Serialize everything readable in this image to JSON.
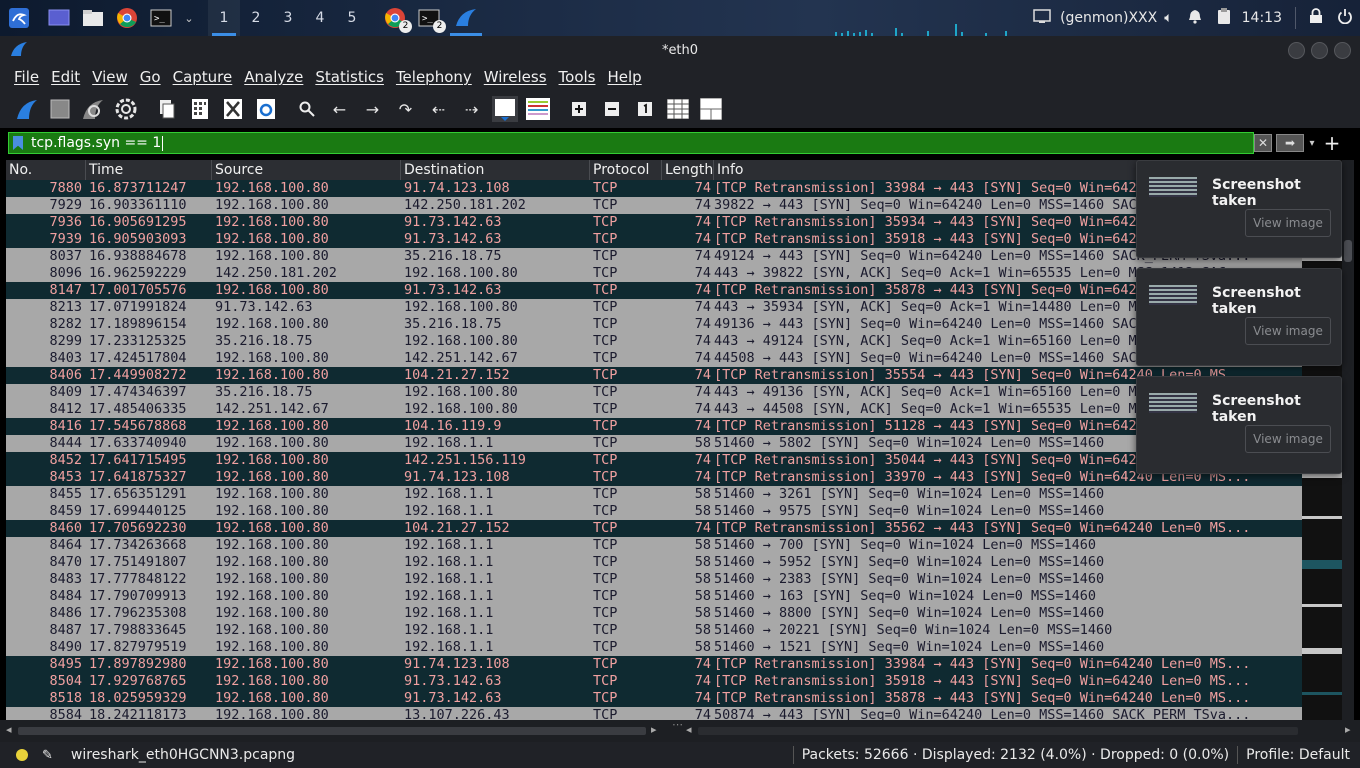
{
  "taskbar": {
    "workspaces": [
      "1",
      "2",
      "3",
      "4",
      "5"
    ],
    "chrome_badge": "2",
    "terminal_badge": "2",
    "genmon": "(genmon)XXX",
    "clock": "14:13"
  },
  "window": {
    "title": "*eth0"
  },
  "menu": [
    "File",
    "Edit",
    "View",
    "Go",
    "Capture",
    "Analyze",
    "Statistics",
    "Telephony",
    "Wireless",
    "Tools",
    "Help"
  ],
  "filter": {
    "value": "tcp.flags.syn == 1"
  },
  "columns": [
    "No.",
    "Time",
    "Source",
    "Destination",
    "Protocol",
    "Length",
    "Info"
  ],
  "packets": [
    {
      "no": "7880",
      "time": "16.873711247",
      "src": "192.168.100.80",
      "dst": "91.74.123.108",
      "proto": "TCP",
      "len": "74",
      "info": "[TCP Retransmission] 33984 → 443 [SYN] Seq=0 Win=64240 Len=0 MS...",
      "bad": true
    },
    {
      "no": "7929",
      "time": "16.903361110",
      "src": "192.168.100.80",
      "dst": "142.250.181.202",
      "proto": "TCP",
      "len": "74",
      "info": "39822 → 443 [SYN] Seq=0 Win=64240 Len=0 MSS=1460 SACK_PERM TSva...",
      "bad": false
    },
    {
      "no": "7936",
      "time": "16.905691295",
      "src": "192.168.100.80",
      "dst": "91.73.142.63",
      "proto": "TCP",
      "len": "74",
      "info": "[TCP Retransmission] 35934 → 443 [SYN] Seq=0 Win=64240 Len=0 MS...",
      "bad": true
    },
    {
      "no": "7939",
      "time": "16.905903093",
      "src": "192.168.100.80",
      "dst": "91.73.142.63",
      "proto": "TCP",
      "len": "74",
      "info": "[TCP Retransmission] 35918 → 443 [SYN] Seq=0 Win=64240 Len=0 MS...",
      "bad": true
    },
    {
      "no": "8037",
      "time": "16.938884678",
      "src": "192.168.100.80",
      "dst": "35.216.18.75",
      "proto": "TCP",
      "len": "74",
      "info": "49124 → 443 [SYN] Seq=0 Win=64240 Len=0 MSS=1460 SACK_PERM TSva...",
      "bad": false
    },
    {
      "no": "8096",
      "time": "16.962592229",
      "src": "142.250.181.202",
      "dst": "192.168.100.80",
      "proto": "TCP",
      "len": "74",
      "info": "443 → 39822 [SYN, ACK] Seq=0 Ack=1 Win=65535 Len=0 MSS=1412 SAC...",
      "bad": false
    },
    {
      "no": "8147",
      "time": "17.001705576",
      "src": "192.168.100.80",
      "dst": "91.73.142.63",
      "proto": "TCP",
      "len": "74",
      "info": "[TCP Retransmission] 35878 → 443 [SYN] Seq=0 Win=64240 Len=0 MS...",
      "bad": true
    },
    {
      "no": "8213",
      "time": "17.071991824",
      "src": "91.73.142.63",
      "dst": "192.168.100.80",
      "proto": "TCP",
      "len": "74",
      "info": "443 → 35934 [SYN, ACK] Seq=0 Ack=1 Win=14480 Len=0 MSS=1412 SAC...",
      "bad": false
    },
    {
      "no": "8282",
      "time": "17.189896154",
      "src": "192.168.100.80",
      "dst": "35.216.18.75",
      "proto": "TCP",
      "len": "74",
      "info": "49136 → 443 [SYN] Seq=0 Win=64240 Len=0 MSS=1460 SACK_PERM TSva...",
      "bad": false
    },
    {
      "no": "8299",
      "time": "17.233125325",
      "src": "35.216.18.75",
      "dst": "192.168.100.80",
      "proto": "TCP",
      "len": "74",
      "info": "443 → 49124 [SYN, ACK] Seq=0 Ack=1 Win=65160 Len=0 MSS=1412 SAC...",
      "bad": false
    },
    {
      "no": "8403",
      "time": "17.424517804",
      "src": "192.168.100.80",
      "dst": "142.251.142.67",
      "proto": "TCP",
      "len": "74",
      "info": "44508 → 443 [SYN] Seq=0 Win=64240 Len=0 MSS=1460 SACK_PERM TSva...",
      "bad": false
    },
    {
      "no": "8406",
      "time": "17.449908272",
      "src": "192.168.100.80",
      "dst": "104.21.27.152",
      "proto": "TCP",
      "len": "74",
      "info": "[TCP Retransmission] 35554 → 443 [SYN] Seq=0 Win=64240 Len=0 MS...",
      "bad": true
    },
    {
      "no": "8409",
      "time": "17.474346397",
      "src": "35.216.18.75",
      "dst": "192.168.100.80",
      "proto": "TCP",
      "len": "74",
      "info": "443 → 49136 [SYN, ACK] Seq=0 Ack=1 Win=65160 Len=0 MSS=1412 SAC...",
      "bad": false
    },
    {
      "no": "8412",
      "time": "17.485406335",
      "src": "142.251.142.67",
      "dst": "192.168.100.80",
      "proto": "TCP",
      "len": "74",
      "info": "443 → 44508 [SYN, ACK] Seq=0 Ack=1 Win=65535 Len=0 MSS=1412 SAC...",
      "bad": false
    },
    {
      "no": "8416",
      "time": "17.545678868",
      "src": "192.168.100.80",
      "dst": "104.16.119.9",
      "proto": "TCP",
      "len": "74",
      "info": "[TCP Retransmission] 51128 → 443 [SYN] Seq=0 Win=64240 Len=0 MS...",
      "bad": true
    },
    {
      "no": "8444",
      "time": "17.633740940",
      "src": "192.168.100.80",
      "dst": "192.168.1.1",
      "proto": "TCP",
      "len": "58",
      "info": "51460 → 5802 [SYN] Seq=0 Win=1024 Len=0 MSS=1460",
      "bad": false
    },
    {
      "no": "8452",
      "time": "17.641715495",
      "src": "192.168.100.80",
      "dst": "142.251.156.119",
      "proto": "TCP",
      "len": "74",
      "info": "[TCP Retransmission] 35044 → 443 [SYN] Seq=0 Win=64240 Len=0 MS...",
      "bad": true
    },
    {
      "no": "8453",
      "time": "17.641875327",
      "src": "192.168.100.80",
      "dst": "91.74.123.108",
      "proto": "TCP",
      "len": "74",
      "info": "[TCP Retransmission] 33970 → 443 [SYN] Seq=0 Win=64240 Len=0 MS...",
      "bad": true
    },
    {
      "no": "8455",
      "time": "17.656351291",
      "src": "192.168.100.80",
      "dst": "192.168.1.1",
      "proto": "TCP",
      "len": "58",
      "info": "51460 → 3261 [SYN] Seq=0 Win=1024 Len=0 MSS=1460",
      "bad": false
    },
    {
      "no": "8459",
      "time": "17.699440125",
      "src": "192.168.100.80",
      "dst": "192.168.1.1",
      "proto": "TCP",
      "len": "58",
      "info": "51460 → 9575 [SYN] Seq=0 Win=1024 Len=0 MSS=1460",
      "bad": false
    },
    {
      "no": "8460",
      "time": "17.705692230",
      "src": "192.168.100.80",
      "dst": "104.21.27.152",
      "proto": "TCP",
      "len": "74",
      "info": "[TCP Retransmission] 35562 → 443 [SYN] Seq=0 Win=64240 Len=0 MS...",
      "bad": true
    },
    {
      "no": "8464",
      "time": "17.734263668",
      "src": "192.168.100.80",
      "dst": "192.168.1.1",
      "proto": "TCP",
      "len": "58",
      "info": "51460 → 700 [SYN] Seq=0 Win=1024 Len=0 MSS=1460",
      "bad": false
    },
    {
      "no": "8470",
      "time": "17.751491807",
      "src": "192.168.100.80",
      "dst": "192.168.1.1",
      "proto": "TCP",
      "len": "58",
      "info": "51460 → 5952 [SYN] Seq=0 Win=1024 Len=0 MSS=1460",
      "bad": false
    },
    {
      "no": "8483",
      "time": "17.777848122",
      "src": "192.168.100.80",
      "dst": "192.168.1.1",
      "proto": "TCP",
      "len": "58",
      "info": "51460 → 2383 [SYN] Seq=0 Win=1024 Len=0 MSS=1460",
      "bad": false
    },
    {
      "no": "8484",
      "time": "17.790709913",
      "src": "192.168.100.80",
      "dst": "192.168.1.1",
      "proto": "TCP",
      "len": "58",
      "info": "51460 → 163 [SYN] Seq=0 Win=1024 Len=0 MSS=1460",
      "bad": false
    },
    {
      "no": "8486",
      "time": "17.796235308",
      "src": "192.168.100.80",
      "dst": "192.168.1.1",
      "proto": "TCP",
      "len": "58",
      "info": "51460 → 8800 [SYN] Seq=0 Win=1024 Len=0 MSS=1460",
      "bad": false
    },
    {
      "no": "8487",
      "time": "17.798833645",
      "src": "192.168.100.80",
      "dst": "192.168.1.1",
      "proto": "TCP",
      "len": "58",
      "info": "51460 → 20221 [SYN] Seq=0 Win=1024 Len=0 MSS=1460",
      "bad": false
    },
    {
      "no": "8490",
      "time": "17.827979519",
      "src": "192.168.100.80",
      "dst": "192.168.1.1",
      "proto": "TCP",
      "len": "58",
      "info": "51460 → 1521 [SYN] Seq=0 Win=1024 Len=0 MSS=1460",
      "bad": false
    },
    {
      "no": "8495",
      "time": "17.897892980",
      "src": "192.168.100.80",
      "dst": "91.74.123.108",
      "proto": "TCP",
      "len": "74",
      "info": "[TCP Retransmission] 33984 → 443 [SYN] Seq=0 Win=64240 Len=0 MS...",
      "bad": true
    },
    {
      "no": "8504",
      "time": "17.929768765",
      "src": "192.168.100.80",
      "dst": "91.73.142.63",
      "proto": "TCP",
      "len": "74",
      "info": "[TCP Retransmission] 35918 → 443 [SYN] Seq=0 Win=64240 Len=0 MS...",
      "bad": true
    },
    {
      "no": "8518",
      "time": "18.025959329",
      "src": "192.168.100.80",
      "dst": "91.73.142.63",
      "proto": "TCP",
      "len": "74",
      "info": "[TCP Retransmission] 35878 → 443 [SYN] Seq=0 Win=64240 Len=0 MS...",
      "bad": true
    },
    {
      "no": "8584",
      "time": "18.242118173",
      "src": "192.168.100.80",
      "dst": "13.107.226.43",
      "proto": "TCP",
      "len": "74",
      "info": "50874 → 443 [SYN] Seq=0 Win=64240 Len=0 MSS=1460 SACK_PERM TSva...",
      "bad": false
    }
  ],
  "toasts": [
    {
      "title": "Screenshot taken",
      "button": "View image"
    },
    {
      "title": "Screenshot taken",
      "button": "View image"
    },
    {
      "title": "Screenshot taken",
      "button": "View image"
    }
  ],
  "status": {
    "file": "wireshark_eth0HGCNN3.pcapng",
    "packets": "Packets: 52666 · Displayed: 2132 (4.0%) · Dropped: 0 (0.0%)",
    "profile": "Profile: Default"
  },
  "colors": {
    "bad_row_bg": "#0f2a31",
    "bad_row_fg": "#f0a0a0",
    "normal_row_bg": "#a8a8a8",
    "filter_bg": "#1a7a12"
  },
  "icons": {
    "taskbar": [
      "kali-menu-icon",
      "desktop-icon",
      "file-manager-icon",
      "chrome-icon",
      "terminal-icon",
      "wireshark-icon",
      "display-icon",
      "volume-icon",
      "bell-icon",
      "clipboard-icon",
      "lock-icon",
      "power-icon"
    ],
    "toolbar": [
      "start-capture-icon",
      "stop-capture-icon",
      "restart-capture-icon",
      "capture-options-icon",
      "open-file-icon",
      "save-file-icon",
      "close-file-icon",
      "reload-file-icon",
      "find-packet-icon",
      "go-back-icon",
      "go-forward-icon",
      "go-to-packet-icon",
      "first-packet-icon",
      "last-packet-icon",
      "autoscroll-icon",
      "colorize-icon",
      "zoom-in-icon",
      "zoom-out-icon",
      "normal-size-icon",
      "resize-columns-icon",
      "layout-icon"
    ]
  }
}
